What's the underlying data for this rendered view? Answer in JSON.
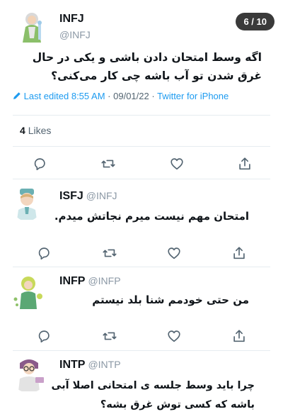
{
  "page_counter": "6 / 10",
  "main_tweet": {
    "name": "INFJ",
    "handle": "@INFJ",
    "text_line1": "اگه وسط امتحان دادن باشی و یکی در حال",
    "text_line2": "غرق شدن تو آب باشه چی کار می‌کنی؟",
    "edited_label": "Last edited 8:55 AM",
    "date": "09/01/22",
    "source": "Twitter for iPhone",
    "likes_count": "4",
    "likes_label": "Likes"
  },
  "replies": [
    {
      "name": "ISFJ",
      "handle": "@INFJ",
      "text": "امتحان مهم نیست میرم نجاتش میدم."
    },
    {
      "name": "INFP",
      "handle": "@INFP",
      "text": "من حتی خودمم شنا بلد نیستم"
    },
    {
      "name": "INTP",
      "handle": "@INTP",
      "text_line1": "چرا باید وسط جلسه ی امتحانی اصلا آبی",
      "text_line2": "باشه که کسی توش غرق بشه؟"
    }
  ],
  "icons": [
    "reply-icon",
    "retweet-icon",
    "like-icon",
    "share-icon",
    "pencil-icon"
  ],
  "colors": {
    "link": "#1d9bf0",
    "muted": "#536471",
    "handle": "#8b98a5",
    "divider": "#e6ecf0"
  }
}
